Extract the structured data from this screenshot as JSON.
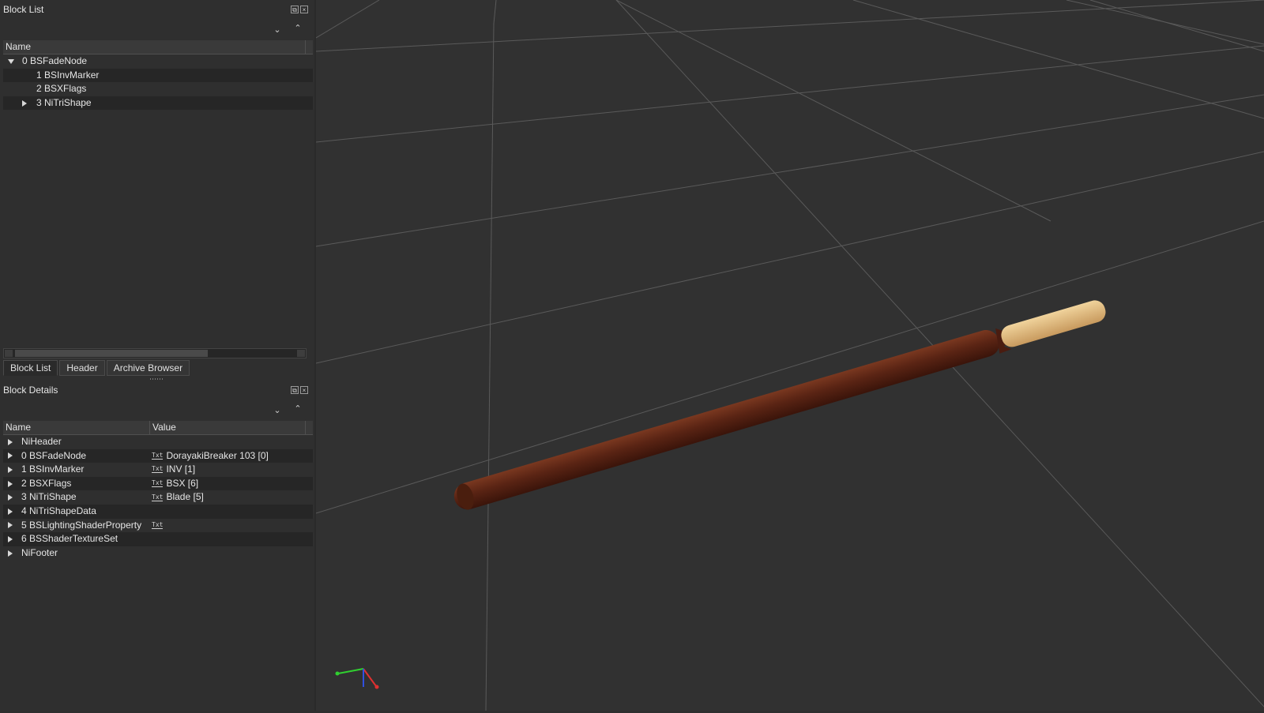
{
  "block_list": {
    "title": "Block List",
    "header": "Name",
    "rows": [
      {
        "label": "0 BSFadeNode",
        "expand": "down",
        "indent": 0
      },
      {
        "label": "1 BSInvMarker",
        "expand": "none",
        "indent": 1
      },
      {
        "label": "2 BSXFlags",
        "expand": "none",
        "indent": 1
      },
      {
        "label": "3 NiTriShape",
        "expand": "right",
        "indent": 1
      }
    ]
  },
  "tabs": [
    "Block List",
    "Header",
    "Archive Browser"
  ],
  "block_details": {
    "title": "Block Details",
    "headers": [
      "Name",
      "Value"
    ],
    "rows": [
      {
        "name": "NiHeader",
        "value": "",
        "txt": false
      },
      {
        "name": "0 BSFadeNode",
        "value": "DorayakiBreaker 103 [0]",
        "txt": true
      },
      {
        "name": "1 BSInvMarker",
        "value": "INV [1]",
        "txt": true
      },
      {
        "name": "2 BSXFlags",
        "value": "BSX [6]",
        "txt": true
      },
      {
        "name": "3 NiTriShape",
        "value": "Blade [5]",
        "txt": true
      },
      {
        "name": "4 NiTriShapeData",
        "value": "",
        "txt": false
      },
      {
        "name": "5 BSLightingShaderProperty",
        "value": "",
        "txt": true
      },
      {
        "name": "6 BSShaderTextureSet",
        "value": "",
        "txt": false
      },
      {
        "name": "NiFooter",
        "value": "",
        "txt": false
      }
    ]
  },
  "txt_icon_label": "Txt",
  "colors": {
    "stick_brown": "#5a2414",
    "stick_tip": "#e2bf86",
    "axis_x": "#e03030",
    "axis_y": "#30d030",
    "axis_z": "#3050e0"
  }
}
